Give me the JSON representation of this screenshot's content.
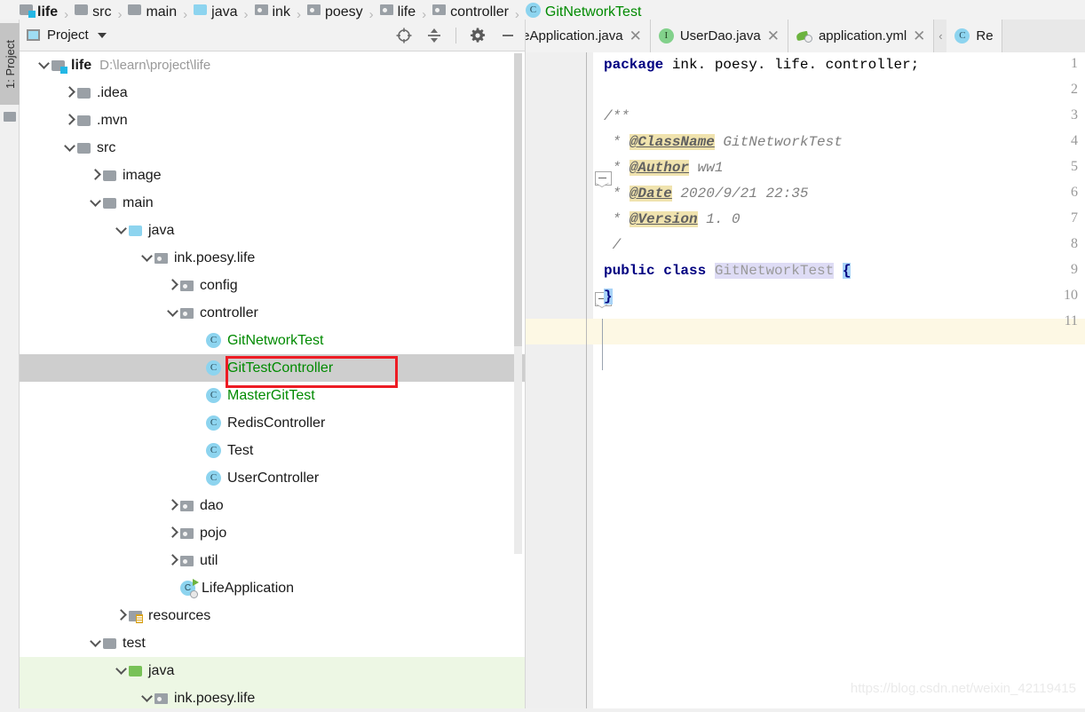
{
  "breadcrumb": {
    "items": [
      {
        "label": "life",
        "icon": "folder-module-icon",
        "style": "bold"
      },
      {
        "label": "src",
        "icon": "folder-icon",
        "style": "normal"
      },
      {
        "label": "main",
        "icon": "folder-icon",
        "style": "normal"
      },
      {
        "label": "java",
        "icon": "folder-source-icon",
        "style": "normal"
      },
      {
        "label": "ink",
        "icon": "package-icon",
        "style": "normal"
      },
      {
        "label": "poesy",
        "icon": "package-icon",
        "style": "normal"
      },
      {
        "label": "life",
        "icon": "package-icon",
        "style": "normal"
      },
      {
        "label": "controller",
        "icon": "package-icon",
        "style": "normal"
      },
      {
        "label": "GitNetworkTest",
        "icon": "class-icon",
        "style": "green"
      }
    ],
    "separator": "›"
  },
  "toolstrip": {
    "project_tab_label": "1: Project",
    "folder_icon": "folder-icon"
  },
  "panel": {
    "title": "Project",
    "title_icon": "project-view-icon",
    "dropdown_icon": "chevron-down-icon",
    "tools": [
      {
        "name": "locate-icon",
        "title": "Select Opened File"
      },
      {
        "name": "collapse-all-icon",
        "title": "Collapse All"
      },
      {
        "name": "settings-gear-icon",
        "title": "Settings"
      },
      {
        "name": "hide-minimize-icon",
        "title": "Hide"
      }
    ]
  },
  "tree": {
    "selected_index": 11,
    "items": [
      {
        "label": "life",
        "path": "D:\\learn\\project\\life",
        "indent": 0,
        "arrow": "down",
        "icon": "folder-module-icon",
        "style": "bold"
      },
      {
        "label": ".idea",
        "path": "",
        "indent": 1,
        "arrow": "right",
        "icon": "folder-icon",
        "style": "normal"
      },
      {
        "label": ".mvn",
        "path": "",
        "indent": 1,
        "arrow": "right",
        "icon": "folder-icon",
        "style": "normal"
      },
      {
        "label": "src",
        "path": "",
        "indent": 1,
        "arrow": "down",
        "icon": "folder-icon",
        "style": "normal"
      },
      {
        "label": "image",
        "path": "",
        "indent": 2,
        "arrow": "right",
        "icon": "folder-icon",
        "style": "normal"
      },
      {
        "label": "main",
        "path": "",
        "indent": 2,
        "arrow": "down",
        "icon": "folder-icon",
        "style": "normal"
      },
      {
        "label": "java",
        "path": "",
        "indent": 3,
        "arrow": "down",
        "icon": "folder-source-icon",
        "style": "normal"
      },
      {
        "label": "ink.poesy.life",
        "path": "",
        "indent": 4,
        "arrow": "down",
        "icon": "package-icon",
        "style": "normal"
      },
      {
        "label": "config",
        "path": "",
        "indent": 5,
        "arrow": "right",
        "icon": "package-icon",
        "style": "normal"
      },
      {
        "label": "controller",
        "path": "",
        "indent": 5,
        "arrow": "down",
        "icon": "package-icon",
        "style": "normal"
      },
      {
        "label": "GitNetworkTest",
        "path": "",
        "indent": 6,
        "arrow": "none",
        "icon": "class-icon",
        "style": "green"
      },
      {
        "label": "GitTestController",
        "path": "",
        "indent": 6,
        "arrow": "none",
        "icon": "class-icon",
        "style": "green"
      },
      {
        "label": "MasterGitTest",
        "path": "",
        "indent": 6,
        "arrow": "none",
        "icon": "class-icon",
        "style": "green"
      },
      {
        "label": "RedisController",
        "path": "",
        "indent": 6,
        "arrow": "none",
        "icon": "class-icon",
        "style": "normal"
      },
      {
        "label": "Test",
        "path": "",
        "indent": 6,
        "arrow": "none",
        "icon": "class-icon",
        "style": "normal"
      },
      {
        "label": "UserController",
        "path": "",
        "indent": 6,
        "arrow": "none",
        "icon": "class-icon",
        "style": "normal"
      },
      {
        "label": "dao",
        "path": "",
        "indent": 5,
        "arrow": "right",
        "icon": "package-icon",
        "style": "normal"
      },
      {
        "label": "pojo",
        "path": "",
        "indent": 5,
        "arrow": "right",
        "icon": "package-icon",
        "style": "normal"
      },
      {
        "label": "util",
        "path": "",
        "indent": 5,
        "arrow": "right",
        "icon": "package-icon",
        "style": "normal"
      },
      {
        "label": "LifeApplication",
        "path": "",
        "indent": 5,
        "arrow": "none",
        "icon": "spring-class-icon",
        "style": "normal"
      },
      {
        "label": "resources",
        "path": "",
        "indent": 3,
        "arrow": "right",
        "icon": "resources-folder-icon",
        "style": "normal"
      },
      {
        "label": "test",
        "path": "",
        "indent": 2,
        "arrow": "down",
        "icon": "folder-icon",
        "style": "normal"
      },
      {
        "label": "java",
        "path": "",
        "indent": 3,
        "arrow": "down",
        "icon": "folder-test-source-icon",
        "style": "normal",
        "row": "testsrc"
      },
      {
        "label": "ink.poesy.life",
        "path": "",
        "indent": 4,
        "arrow": "down",
        "icon": "package-icon",
        "style": "normal",
        "row": "testsrc"
      }
    ]
  },
  "editor": {
    "tabs": [
      {
        "label": "feApplication.java",
        "icon": "none",
        "clipped": true,
        "close": "✕"
      },
      {
        "label": "UserDao.java",
        "icon": "interface-icon",
        "clipped": false,
        "close": "✕"
      },
      {
        "label": "application.yml",
        "icon": "yaml-icon",
        "clipped": false,
        "close": "✕"
      },
      {
        "label": "Re",
        "icon": "class-icon",
        "clipped": false,
        "close": ""
      }
    ],
    "tab_scroll_left_icon": "chevron-left-icon",
    "line_numbers": [
      "1",
      "2",
      "3",
      "4",
      "5",
      "6",
      "7",
      "8",
      "9",
      "10",
      "11"
    ],
    "caret_line": 9,
    "code_lines": [
      {
        "n": 1,
        "segments": [
          {
            "t": "package",
            "c": "kw"
          },
          {
            "t": " ink. poesy. life. controller;",
            "c": "plain"
          }
        ]
      },
      {
        "n": 2,
        "segments": []
      },
      {
        "n": 3,
        "segments": [
          {
            "t": "/**",
            "c": "cmt"
          }
        ]
      },
      {
        "n": 4,
        "segments": [
          {
            "t": " * ",
            "c": "cmt"
          },
          {
            "t": "@ClassName",
            "c": "tag"
          },
          {
            "t": " GitNetworkTest",
            "c": "cmt"
          }
        ]
      },
      {
        "n": 5,
        "segments": [
          {
            "t": " * ",
            "c": "cmt"
          },
          {
            "t": "@Author",
            "c": "tag"
          },
          {
            "t": " ww1",
            "c": "cmt"
          }
        ]
      },
      {
        "n": 6,
        "segments": [
          {
            "t": " * ",
            "c": "cmt"
          },
          {
            "t": "@Date",
            "c": "tag"
          },
          {
            "t": " 2020/9/21 22:35",
            "c": "cmt"
          }
        ]
      },
      {
        "n": 7,
        "segments": [
          {
            "t": " * ",
            "c": "cmt"
          },
          {
            "t": "@Version",
            "c": "tag"
          },
          {
            "t": " 1. 0",
            "c": "cmt"
          }
        ]
      },
      {
        "n": 8,
        "segments": [
          {
            "t": " /",
            "c": "cmt"
          }
        ]
      },
      {
        "n": 9,
        "segments": [
          {
            "t": "public class ",
            "c": "kw"
          },
          {
            "t": "GitNetworkTest",
            "c": "cls-id"
          },
          {
            "t": " ",
            "c": "plain"
          },
          {
            "t": "{",
            "c": "brace"
          }
        ]
      },
      {
        "n": 10,
        "segments": [
          {
            "t": "}",
            "c": "brace"
          }
        ]
      },
      {
        "n": 11,
        "segments": []
      }
    ],
    "fold_markers": [
      {
        "line": 3,
        "type": "fold-start"
      },
      {
        "line": 8,
        "type": "fold-end"
      }
    ],
    "intention_bulb_icon": "intention-bulb-icon"
  },
  "watermark": "https://blog.csdn.net/weixin_42119415",
  "colors": {
    "selection_gray": "#cecece",
    "annotation_red": "#ed1c24",
    "vcs_green": "#008a00",
    "test_source_green": "#edf7e4",
    "caret_line": "#fdf8e4",
    "javadoc_tag_bg": "#f0e3ae",
    "identifier_highlight": "#dedcf5",
    "brace_match": "#a8d3f7"
  }
}
